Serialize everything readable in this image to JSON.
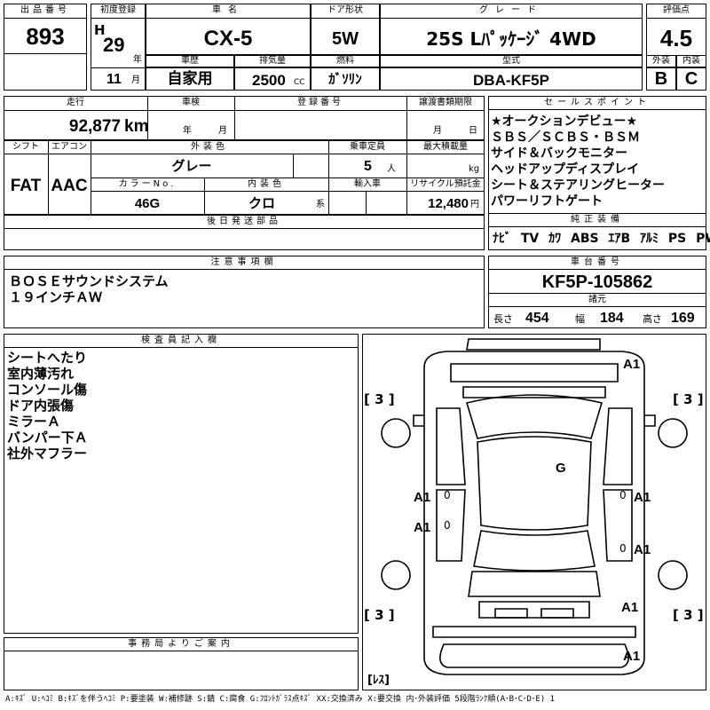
{
  "header": {
    "lot_no_label": "出品番号",
    "lot_no": "893",
    "first_reg_label": "初度登録",
    "era": "H",
    "year": "29",
    "year_unit": "年",
    "month": "11",
    "month_unit": "月",
    "car_name_label": "車名",
    "car_name": "CX-5",
    "door_label": "ドア形状",
    "door": "5W",
    "grade_label": "グレード",
    "grade": "25S Lﾊﾟｯｹｰｼﾞ 4WD",
    "score_label": "評価点",
    "score": "4.5",
    "ext_label": "外装",
    "ext": "B",
    "int_label": "内装",
    "int": "C",
    "history_label": "車歴",
    "history": "自家用",
    "displacement_label": "排気量",
    "displacement": "2500",
    "displacement_unit": "CC",
    "fuel_label": "燃料",
    "fuel": "ｶﾞｿﾘﾝ",
    "model_label": "型式",
    "model": "DBA-KF5P"
  },
  "row2": {
    "mileage_label": "走行",
    "mileage": "92,877",
    "mileage_unit": "km",
    "inspection_label": "車検",
    "insp_year": "年",
    "insp_month": "月",
    "plate_label": "登録番号",
    "transfer_label": "譲渡書類期限",
    "transfer_month": "月",
    "transfer_day": "日"
  },
  "row3": {
    "shift_label": "シフト",
    "shift": "FAT",
    "ac_label": "エアコン",
    "ac": "AAC",
    "color_label": "外装色",
    "color": "グレー",
    "capacity_label": "乗車定員",
    "capacity": "5",
    "capacity_unit": "人",
    "load_label": "最大積載量",
    "load_unit": "kg",
    "color_no_label": "カラーNo.",
    "color_no": "46G",
    "int_color_label": "内装色",
    "int_color": "クロ",
    "int_color_unit": "系",
    "import_label": "輸入車",
    "recycle_label": "リサイクル預託金",
    "recycle": "12,480",
    "recycle_unit": "円"
  },
  "later_parts_label": "後日発送部品",
  "sales_points": {
    "label": "セールスポイント",
    "items": [
      "★オークションデビュー★",
      "ＳＢＳ／ＳＣＢＳ・ＢＳＭ",
      "サイド＆バックモニター",
      "ヘッドアップディスプレイ",
      "シート＆ステアリングヒーター",
      "パワーリフトゲート"
    ]
  },
  "equipment": {
    "label": "純正装備",
    "items": [
      "ﾅﾋﾞ",
      "TV",
      "ｶﾜ",
      "ABS",
      "ｴｱB",
      "ｱﾙﾐ",
      "PS",
      "PW"
    ]
  },
  "notice": {
    "label": "注意事項欄",
    "lines": [
      "ＢＯＳＥサウンドシステム",
      "１９インチＡＷ"
    ]
  },
  "chassis": {
    "label": "車台番号",
    "value": "KF5P-105862"
  },
  "dimensions": {
    "label": "諸元",
    "length_label": "長さ",
    "length": "454",
    "width_label": "幅",
    "width": "184",
    "height_label": "高さ",
    "height": "169"
  },
  "inspector": {
    "label": "検査員記入欄",
    "lines": [
      "シートへたり",
      "室内薄汚れ",
      "コンソール傷",
      "ドア内張傷",
      "ミラーＡ",
      "バンパー下Ａ",
      "社外マフラー"
    ]
  },
  "office_label": "事務局よりご案内",
  "diagram": {
    "tire_fl": "[ 3 ]",
    "tire_fr": "[ 3 ]",
    "tire_rl": "[ 3 ]",
    "tire_rr": "[ 3 ]",
    "spare": "[ﾚｽ]",
    "mark_front": "A1",
    "mark_glass": "G",
    "mark_left_front": "A1",
    "mark_right_front": "A1",
    "mark_left_rear": "A1",
    "mark_right_rear": "A1",
    "mark_rear_corner": "A1",
    "mark_rear": "A1",
    "zero_1": "0",
    "zero_2": "0",
    "zero_3": "0",
    "zero_4": "0"
  },
  "legend": "A:ｷｽﾞ U:ﾍｺﾐ B:ｷｽﾞを伴うﾍｺﾐ P:要塗装 W:補修跡 S:錆 C:腐食 G:ﾌﾛﾝﾄｶﾞﾗｽ点ｷｽﾞ XX:交換済み X:要交換 内･外装評価 5段階ﾗﾝｸ順(A･B･C･D･E) 1"
}
